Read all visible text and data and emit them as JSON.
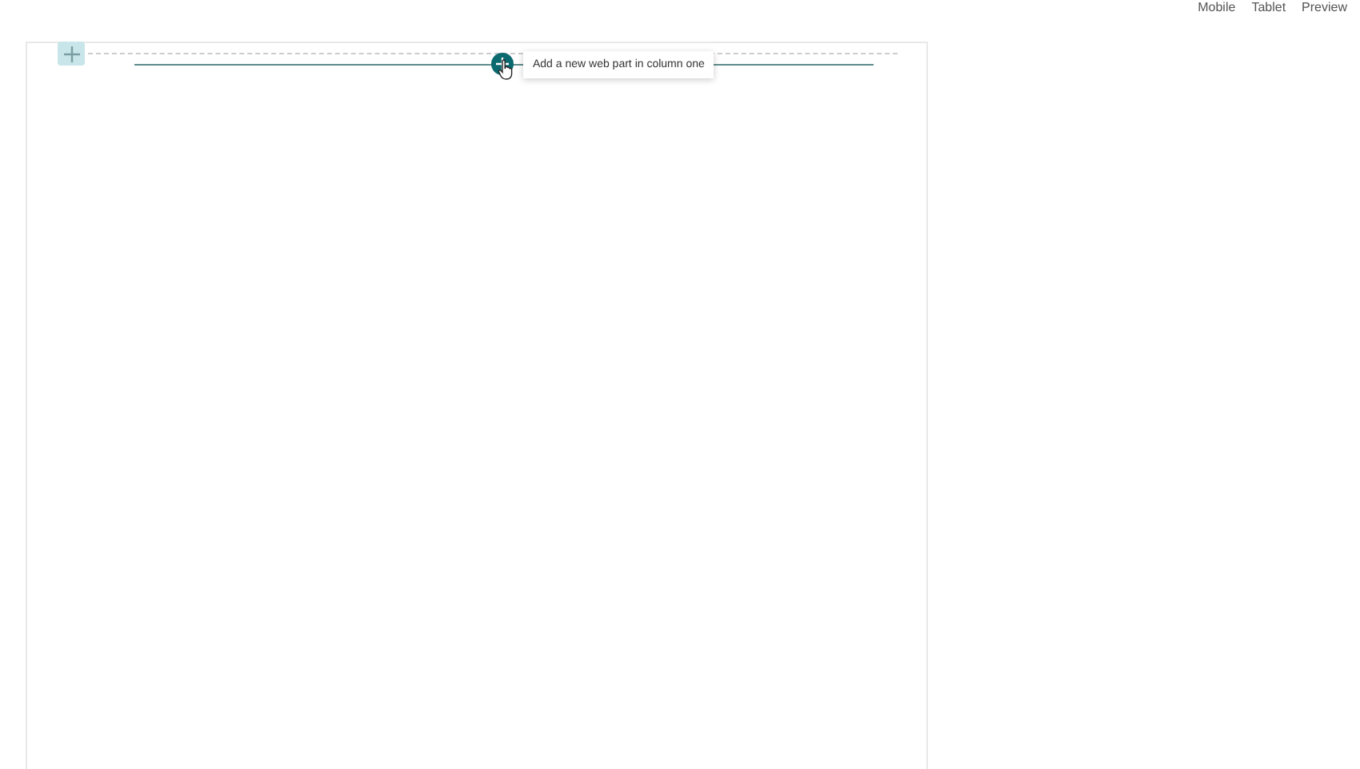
{
  "toolbar": {
    "links": [
      "Mobile",
      "Tablet",
      "Preview"
    ]
  },
  "canvas": {
    "tooltip": "Add a new web part in column one"
  }
}
